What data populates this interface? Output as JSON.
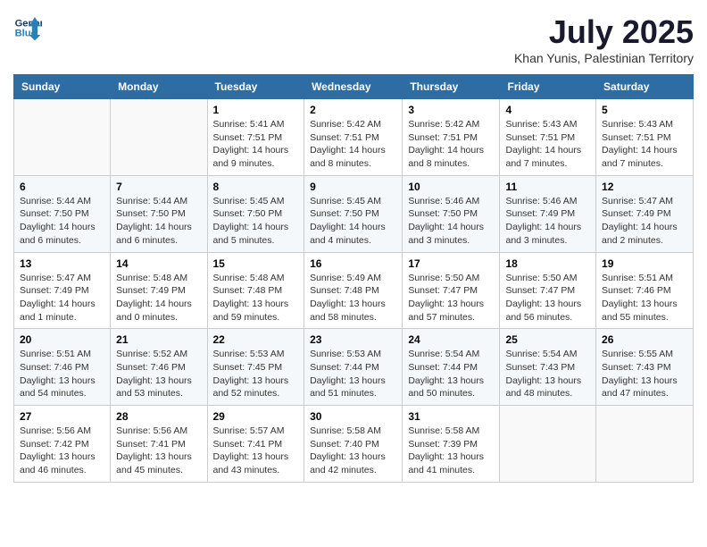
{
  "header": {
    "logo_line1": "General",
    "logo_line2": "Blue",
    "month_title": "July 2025",
    "location": "Khan Yunis, Palestinian Territory"
  },
  "days_of_week": [
    "Sunday",
    "Monday",
    "Tuesday",
    "Wednesday",
    "Thursday",
    "Friday",
    "Saturday"
  ],
  "weeks": [
    [
      {
        "day": "",
        "info": ""
      },
      {
        "day": "",
        "info": ""
      },
      {
        "day": "1",
        "info": "Sunrise: 5:41 AM\nSunset: 7:51 PM\nDaylight: 14 hours and 9 minutes."
      },
      {
        "day": "2",
        "info": "Sunrise: 5:42 AM\nSunset: 7:51 PM\nDaylight: 14 hours and 8 minutes."
      },
      {
        "day": "3",
        "info": "Sunrise: 5:42 AM\nSunset: 7:51 PM\nDaylight: 14 hours and 8 minutes."
      },
      {
        "day": "4",
        "info": "Sunrise: 5:43 AM\nSunset: 7:51 PM\nDaylight: 14 hours and 7 minutes."
      },
      {
        "day": "5",
        "info": "Sunrise: 5:43 AM\nSunset: 7:51 PM\nDaylight: 14 hours and 7 minutes."
      }
    ],
    [
      {
        "day": "6",
        "info": "Sunrise: 5:44 AM\nSunset: 7:50 PM\nDaylight: 14 hours and 6 minutes."
      },
      {
        "day": "7",
        "info": "Sunrise: 5:44 AM\nSunset: 7:50 PM\nDaylight: 14 hours and 6 minutes."
      },
      {
        "day": "8",
        "info": "Sunrise: 5:45 AM\nSunset: 7:50 PM\nDaylight: 14 hours and 5 minutes."
      },
      {
        "day": "9",
        "info": "Sunrise: 5:45 AM\nSunset: 7:50 PM\nDaylight: 14 hours and 4 minutes."
      },
      {
        "day": "10",
        "info": "Sunrise: 5:46 AM\nSunset: 7:50 PM\nDaylight: 14 hours and 3 minutes."
      },
      {
        "day": "11",
        "info": "Sunrise: 5:46 AM\nSunset: 7:49 PM\nDaylight: 14 hours and 3 minutes."
      },
      {
        "day": "12",
        "info": "Sunrise: 5:47 AM\nSunset: 7:49 PM\nDaylight: 14 hours and 2 minutes."
      }
    ],
    [
      {
        "day": "13",
        "info": "Sunrise: 5:47 AM\nSunset: 7:49 PM\nDaylight: 14 hours and 1 minute."
      },
      {
        "day": "14",
        "info": "Sunrise: 5:48 AM\nSunset: 7:49 PM\nDaylight: 14 hours and 0 minutes."
      },
      {
        "day": "15",
        "info": "Sunrise: 5:48 AM\nSunset: 7:48 PM\nDaylight: 13 hours and 59 minutes."
      },
      {
        "day": "16",
        "info": "Sunrise: 5:49 AM\nSunset: 7:48 PM\nDaylight: 13 hours and 58 minutes."
      },
      {
        "day": "17",
        "info": "Sunrise: 5:50 AM\nSunset: 7:47 PM\nDaylight: 13 hours and 57 minutes."
      },
      {
        "day": "18",
        "info": "Sunrise: 5:50 AM\nSunset: 7:47 PM\nDaylight: 13 hours and 56 minutes."
      },
      {
        "day": "19",
        "info": "Sunrise: 5:51 AM\nSunset: 7:46 PM\nDaylight: 13 hours and 55 minutes."
      }
    ],
    [
      {
        "day": "20",
        "info": "Sunrise: 5:51 AM\nSunset: 7:46 PM\nDaylight: 13 hours and 54 minutes."
      },
      {
        "day": "21",
        "info": "Sunrise: 5:52 AM\nSunset: 7:46 PM\nDaylight: 13 hours and 53 minutes."
      },
      {
        "day": "22",
        "info": "Sunrise: 5:53 AM\nSunset: 7:45 PM\nDaylight: 13 hours and 52 minutes."
      },
      {
        "day": "23",
        "info": "Sunrise: 5:53 AM\nSunset: 7:44 PM\nDaylight: 13 hours and 51 minutes."
      },
      {
        "day": "24",
        "info": "Sunrise: 5:54 AM\nSunset: 7:44 PM\nDaylight: 13 hours and 50 minutes."
      },
      {
        "day": "25",
        "info": "Sunrise: 5:54 AM\nSunset: 7:43 PM\nDaylight: 13 hours and 48 minutes."
      },
      {
        "day": "26",
        "info": "Sunrise: 5:55 AM\nSunset: 7:43 PM\nDaylight: 13 hours and 47 minutes."
      }
    ],
    [
      {
        "day": "27",
        "info": "Sunrise: 5:56 AM\nSunset: 7:42 PM\nDaylight: 13 hours and 46 minutes."
      },
      {
        "day": "28",
        "info": "Sunrise: 5:56 AM\nSunset: 7:41 PM\nDaylight: 13 hours and 45 minutes."
      },
      {
        "day": "29",
        "info": "Sunrise: 5:57 AM\nSunset: 7:41 PM\nDaylight: 13 hours and 43 minutes."
      },
      {
        "day": "30",
        "info": "Sunrise: 5:58 AM\nSunset: 7:40 PM\nDaylight: 13 hours and 42 minutes."
      },
      {
        "day": "31",
        "info": "Sunrise: 5:58 AM\nSunset: 7:39 PM\nDaylight: 13 hours and 41 minutes."
      },
      {
        "day": "",
        "info": ""
      },
      {
        "day": "",
        "info": ""
      }
    ]
  ]
}
